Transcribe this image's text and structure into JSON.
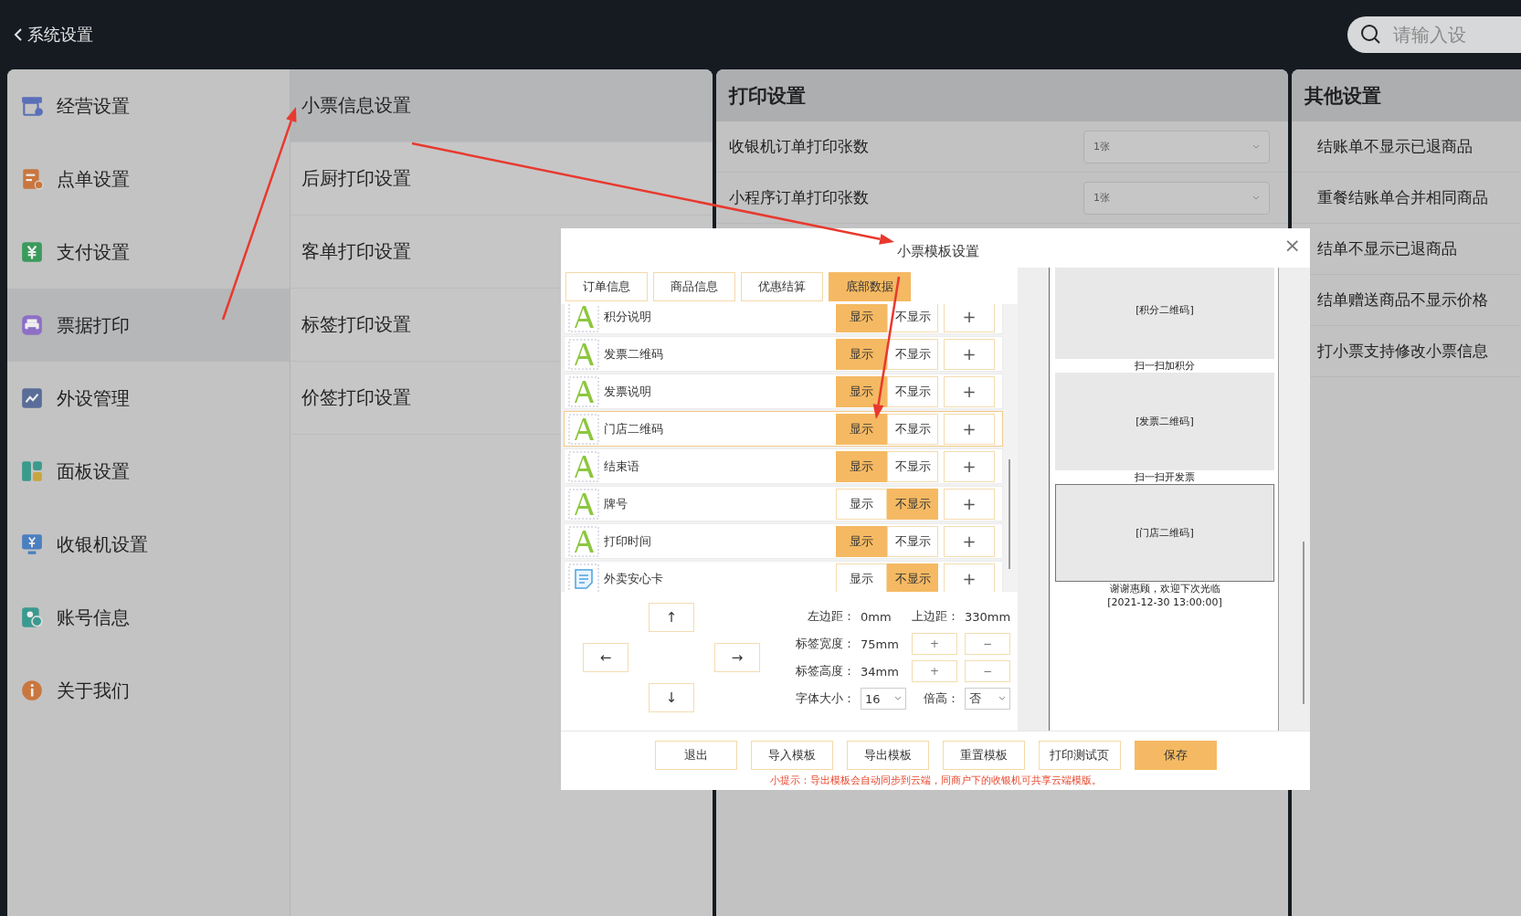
{
  "header": {
    "back_label": "系统设置",
    "search": {
      "placeholder": "请输入设"
    }
  },
  "sidebar": {
    "items": [
      {
        "label": "经营设置",
        "selected": false
      },
      {
        "label": "点单设置",
        "selected": false
      },
      {
        "label": "支付设置",
        "selected": false
      },
      {
        "label": "票据打印",
        "selected": true
      },
      {
        "label": "外设管理",
        "selected": false
      },
      {
        "label": "面板设置",
        "selected": false
      },
      {
        "label": "收银机设置",
        "selected": false
      },
      {
        "label": "账号信息",
        "selected": false
      },
      {
        "label": "关于我们",
        "selected": false
      }
    ]
  },
  "submenu": {
    "items": [
      {
        "label": "小票信息设置",
        "selected": true
      },
      {
        "label": "后厨打印设置",
        "selected": false
      },
      {
        "label": "客单打印设置",
        "selected": false
      },
      {
        "label": "标签打印设置",
        "selected": false
      },
      {
        "label": "价签打印设置",
        "selected": false
      }
    ]
  },
  "print_settings": {
    "title": "打印设置",
    "rows": [
      {
        "label": "收银机订单打印张数",
        "value": "1张"
      },
      {
        "label": "小程序订单打印张数",
        "value": "1张"
      }
    ]
  },
  "other_settings": {
    "title": "其他设置",
    "rows": [
      {
        "label": "结账单不显示已退商品"
      },
      {
        "label": "重餐结账单合并相同商品"
      },
      {
        "label": "结单不显示已退商品"
      },
      {
        "label": "结单赠送商品不显示价格"
      },
      {
        "label": "打小票支持修改小票信息"
      }
    ]
  },
  "dialog": {
    "title": "小票模板设置",
    "close": "×",
    "tabs": [
      {
        "label": "订单信息",
        "selected": false
      },
      {
        "label": "商品信息",
        "selected": false
      },
      {
        "label": "优惠结算",
        "selected": false
      },
      {
        "label": "底部数据",
        "selected": true
      }
    ],
    "elements": [
      {
        "kind": "text",
        "label": "积分说明",
        "shown": true,
        "highlighted": false,
        "show_label": "显示",
        "hide_label": "不显示",
        "add_label": "+"
      },
      {
        "kind": "text",
        "label": "发票二维码",
        "shown": true,
        "highlighted": false,
        "show_label": "显示",
        "hide_label": "不显示",
        "add_label": "+"
      },
      {
        "kind": "text",
        "label": "发票说明",
        "shown": true,
        "highlighted": false,
        "show_label": "显示",
        "hide_label": "不显示",
        "add_label": "+"
      },
      {
        "kind": "text",
        "label": "门店二维码",
        "shown": true,
        "highlighted": true,
        "show_label": "显示",
        "hide_label": "不显示",
        "add_label": "+"
      },
      {
        "kind": "text",
        "label": "结束语",
        "shown": true,
        "highlighted": false,
        "show_label": "显示",
        "hide_label": "不显示",
        "add_label": "+"
      },
      {
        "kind": "text",
        "label": "牌号",
        "shown": false,
        "highlighted": false,
        "show_label": "显示",
        "hide_label": "不显示",
        "add_label": "+"
      },
      {
        "kind": "text",
        "label": "打印时间",
        "shown": true,
        "highlighted": false,
        "show_label": "显示",
        "hide_label": "不显示",
        "add_label": "+"
      },
      {
        "kind": "card",
        "label": "外卖安心卡",
        "shown": false,
        "highlighted": false,
        "show_label": "显示",
        "hide_label": "不显示",
        "add_label": "+"
      }
    ],
    "arrows": {
      "up": "↑",
      "left": "←",
      "right": "→",
      "down": "↓"
    },
    "left_margin": {
      "label": "左边距：",
      "value": "0mm"
    },
    "top_margin": {
      "label": "上边距：",
      "value": "330mm"
    },
    "label_width": {
      "label": "标签宽度：",
      "value": "75mm",
      "plus": "+",
      "minus": "−"
    },
    "label_height": {
      "label": "标签高度：",
      "value": "34mm",
      "plus": "+",
      "minus": "−"
    },
    "font_size": {
      "label": "字体大小：",
      "value": "16"
    },
    "double_height": {
      "label": "倍高：",
      "value": "否"
    },
    "preview": [
      {
        "kind": "qr",
        "text": "[积分二维码]",
        "selected": false
      },
      {
        "kind": "caption",
        "text": "扫一扫加积分"
      },
      {
        "kind": "qr",
        "text": "[发票二维码]",
        "selected": false
      },
      {
        "kind": "caption",
        "text": "扫一扫开发票"
      },
      {
        "kind": "qr",
        "text": "[门店二维码]",
        "selected": true
      },
      {
        "kind": "caption",
        "text": "谢谢惠顾，欢迎下次光临"
      },
      {
        "kind": "caption",
        "text": "[2021-12-30 13:00:00]"
      }
    ],
    "buttons": [
      {
        "label": "退出",
        "kind": "normal"
      },
      {
        "label": "导入模板",
        "kind": "normal"
      },
      {
        "label": "导出模板",
        "kind": "normal"
      },
      {
        "label": "重置模板",
        "kind": "normal"
      },
      {
        "label": "打印测试页",
        "kind": "normal"
      },
      {
        "label": "保存",
        "kind": "primary"
      }
    ],
    "hint": "小提示：导出模板会自动同步到云端，同商户下的收银机可共享云端模版。"
  }
}
